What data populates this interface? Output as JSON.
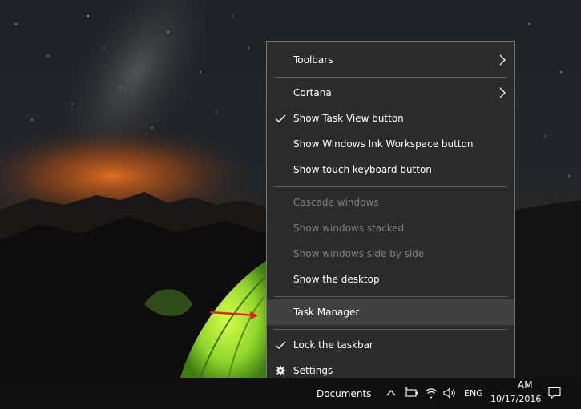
{
  "menu": {
    "items": [
      {
        "label": "Toolbars",
        "submenu": true
      },
      {
        "label": "Cortana",
        "submenu": true
      },
      {
        "label": "Show Task View button",
        "checked": true
      },
      {
        "label": "Show Windows Ink Workspace button"
      },
      {
        "label": "Show touch keyboard button"
      },
      {
        "label": "Cascade windows",
        "disabled": true
      },
      {
        "label": "Show windows stacked",
        "disabled": true
      },
      {
        "label": "Show windows side by side",
        "disabled": true
      },
      {
        "label": "Show the desktop"
      },
      {
        "label": "Task Manager",
        "highlighted": true
      },
      {
        "label": "Lock the taskbar",
        "checked": true
      },
      {
        "label": "Settings",
        "icon": "gear-icon"
      }
    ]
  },
  "taskbar": {
    "documents_label": "Documents",
    "language": "ENG",
    "clock_time_fragment": "AM",
    "clock_date": "10/17/2016",
    "icons": [
      "chevron-up-icon",
      "battery-icon",
      "wifi-icon",
      "speaker-icon",
      "action-center-icon"
    ]
  },
  "colors": {
    "menu_bg": "#2b2b2b",
    "menu_highlight": "#414141",
    "menu_text": "#ffffff",
    "menu_disabled_text": "#7f7f7f",
    "taskbar_bg": "#101010",
    "annotation_arrow": "#e0211d"
  }
}
